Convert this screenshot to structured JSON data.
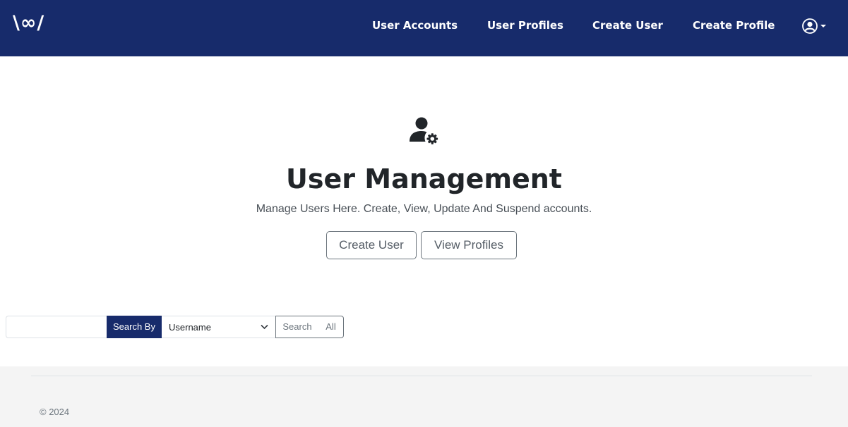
{
  "navbar": {
    "brand": "\\∞/",
    "links": [
      "User Accounts",
      "User Profiles",
      "Create User",
      "Create Profile"
    ],
    "account_icon": "user-circle-icon",
    "dropdown_icon": "caret-down-icon",
    "background_color": "#172b6b"
  },
  "hero": {
    "icon": "user-gear-icon",
    "title": "User Management",
    "subtitle": "Manage Users Here. Create, View, Update And Suspend accounts.",
    "buttons": {
      "create_user": "Create User",
      "view_profiles": "View Profiles"
    }
  },
  "search": {
    "input_value": "",
    "search_by_label": "Search By",
    "selected_option": "Username",
    "search_button": "Search",
    "all_button": "All"
  },
  "footer": {
    "copyright": "© 2024"
  }
}
